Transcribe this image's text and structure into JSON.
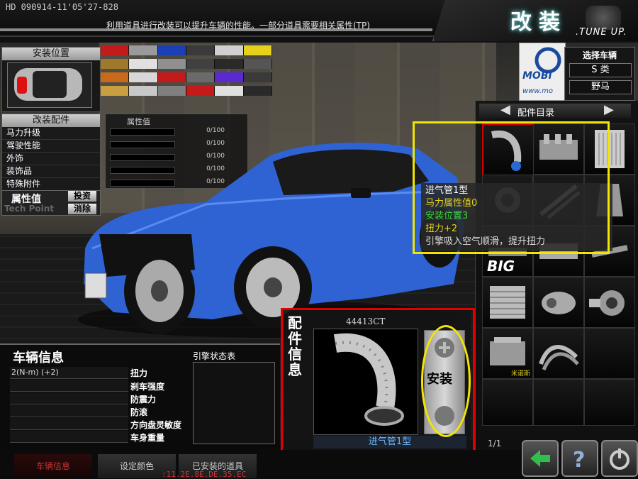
{
  "header": {
    "version": "HD 090914-11'05'27-828",
    "hint": "利用道具进行改装可以提升车辆的性能。一部分道具需要相关属性(TP)",
    "title": "改装",
    "subtitle": ".TUNE UP."
  },
  "install_position": {
    "label": "安装位置"
  },
  "color_palette": [
    [
      "#c41a1a",
      "#9a9a9a",
      "#1b3fb5",
      "#3a3a3a",
      "#d0d0d0",
      "#e6d21a"
    ],
    [
      "#a07a2a",
      "#e0e0e0",
      "#909090",
      "#404040",
      "#2a2a2a",
      "#555555"
    ],
    [
      "#c86a1a",
      "#d8d8d8",
      "#c41a1a",
      "#6a6a6a",
      "#5a2ad0",
      "#3a3a3a"
    ],
    [
      "#c8a040",
      "#c8c8c8",
      "#808080",
      "#c41a1a",
      "#e0e0e0",
      "#2a2a2a"
    ]
  ],
  "parts_panel": {
    "title": "改装配件",
    "items": [
      "马力升级",
      "驾驶性能",
      "外饰",
      "装饰品",
      "特殊附件"
    ]
  },
  "attributes": {
    "title": "属性值",
    "values": [
      "0/100",
      "0/100",
      "0/100",
      "0/100",
      "0/100"
    ]
  },
  "tech_point": {
    "label": "属性值",
    "sub": "Tech Point",
    "invest": "投资",
    "clear": "消除"
  },
  "vehicle_select": {
    "title": "选择车辆",
    "class": "S 类",
    "model": "野马"
  },
  "catalog": {
    "title": "配件目录",
    "page": "1/1",
    "brand_label": "BIG",
    "brand_label2": "米诺斯"
  },
  "tooltip": {
    "name": "进气管1型",
    "hp": "马力属性值0",
    "slot": "安装位置3",
    "torque": "扭力+2",
    "desc": "引擎吸入空气顺滑，提升扭力"
  },
  "vehicle_info": {
    "title": "车辆信息",
    "rows": [
      "2(N-m)  (+2)",
      "",
      "",
      "",
      "",
      ""
    ],
    "labels": [
      "扭力",
      "刹车强度",
      "防震力",
      "防滚",
      "方向盘灵敏度",
      "车身重量"
    ],
    "engine_title": "引擎状态表"
  },
  "part_info": {
    "title": "配件信息",
    "code": "44413CT",
    "name": "进气管1型",
    "install": "安装"
  },
  "bottom_tabs": [
    "车辆信息",
    "设定颜色",
    "已安装的道具"
  ],
  "debug": ":11.2E.8E.DE.35.EC"
}
